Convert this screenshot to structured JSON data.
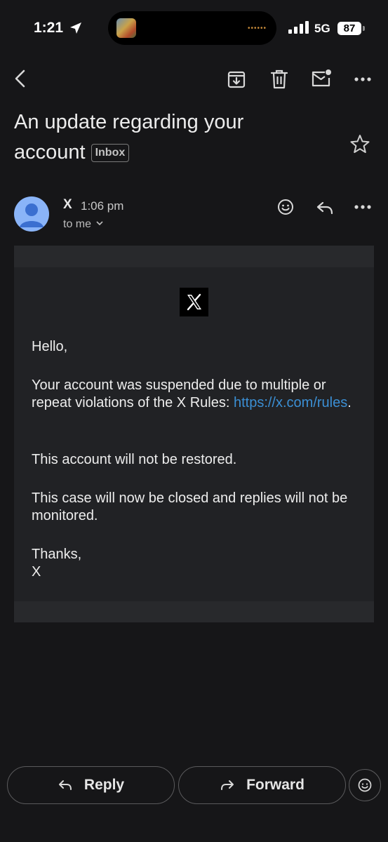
{
  "status_bar": {
    "time": "1:21",
    "network": "5G",
    "battery": "87"
  },
  "toolbar": {
    "icons": [
      "back-arrow-icon",
      "archive-icon",
      "delete-icon",
      "mark-unread-icon",
      "more-icon"
    ]
  },
  "email": {
    "subject": "An update regarding your account",
    "label": "Inbox",
    "sender": "X",
    "time": "1:06 pm",
    "recipient": "to me",
    "body": {
      "greeting": "Hello,",
      "paragraph1_text": "Your account was suspended due to multiple or repeat violations of the X Rules: ",
      "paragraph1_link": "https://x.com/rules",
      "paragraph1_end": ".",
      "paragraph2": "This account will not be restored.",
      "paragraph3": "This case will now be closed and replies will not be monitored.",
      "signoff": "Thanks,",
      "signature": "X"
    }
  },
  "actions": {
    "reply_label": "Reply",
    "forward_label": "Forward"
  },
  "colors": {
    "background": "#161618",
    "link": "#3b8fd4",
    "avatar": "#8ab4f8"
  }
}
